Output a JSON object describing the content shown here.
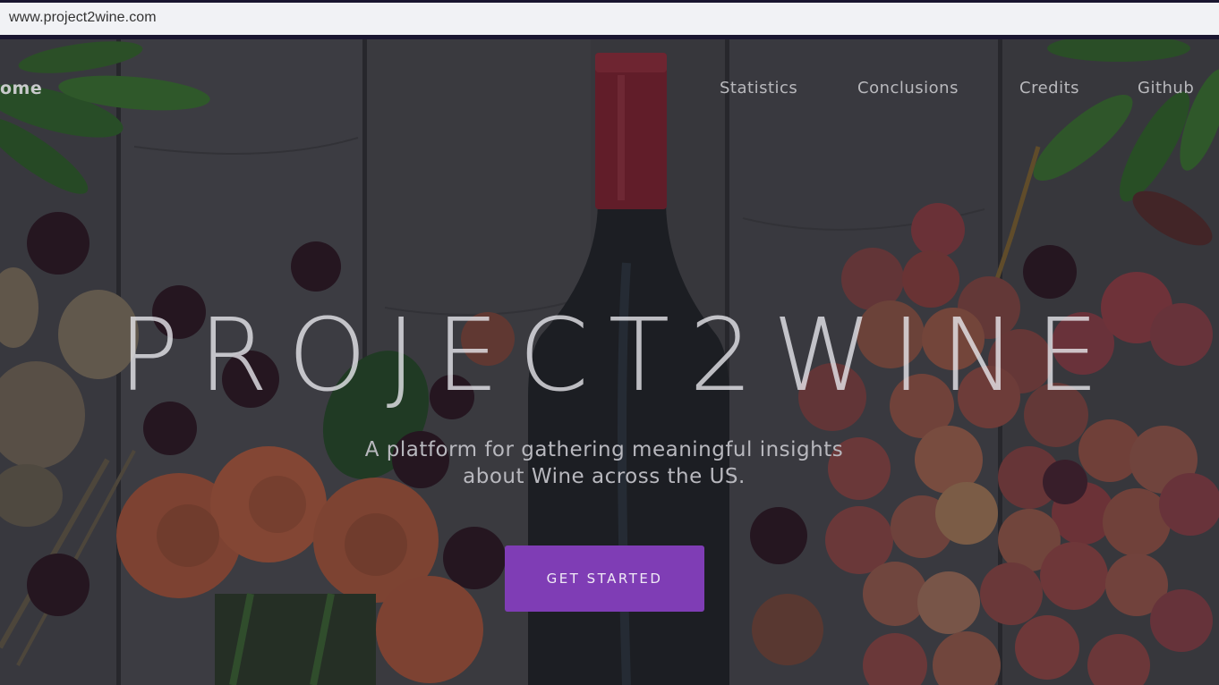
{
  "browser": {
    "url": "www.project2wine.com"
  },
  "nav": {
    "home": "ome",
    "items": [
      "Statistics",
      "Conclusions",
      "Credits",
      "Github"
    ]
  },
  "hero": {
    "title": "PROJECT2WINE",
    "subtitle_line1": "A platform for gathering meaningful insights",
    "subtitle_line2": "about Wine across the US.",
    "cta_label": "GET STARTED",
    "cta_color": "#7f3db5"
  },
  "icons": [
    "wine-bottle-image",
    "grapes-image",
    "roses-image",
    "leaves-image"
  ]
}
